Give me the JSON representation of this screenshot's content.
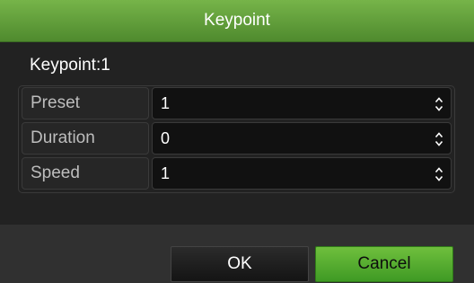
{
  "dialog": {
    "title": "Keypoint",
    "subtitle": "Keypoint:1"
  },
  "fields": [
    {
      "label": "Preset",
      "value": "1"
    },
    {
      "label": "Duration",
      "value": "0"
    },
    {
      "label": "Speed",
      "value": "1"
    }
  ],
  "buttons": {
    "ok_label": "OK",
    "cancel_label": "Cancel"
  },
  "icons": {
    "spinner": "up-down-arrows-icon"
  },
  "colors": {
    "accent_green": "#5f9e38",
    "background": "#222222",
    "footer": "#303030"
  }
}
